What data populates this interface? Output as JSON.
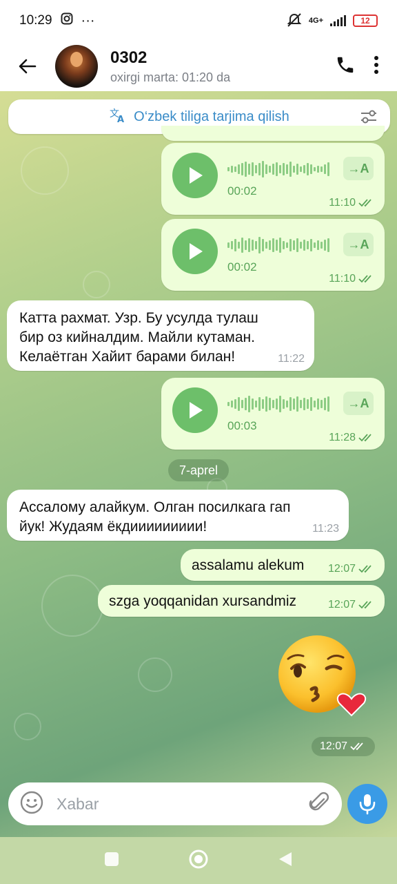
{
  "status_bar": {
    "time": "10:29",
    "network": "4G+",
    "battery": "12"
  },
  "header": {
    "name": "0302",
    "status": "oxirgi marta: 01:20 da"
  },
  "translate_bar": {
    "label": "O‘zbek tiliga tarjima qilish"
  },
  "messages": [
    {
      "type": "voice",
      "direction": "out",
      "duration": "00:02",
      "time": "11:10",
      "translate": "→A"
    },
    {
      "type": "voice",
      "direction": "out",
      "duration": "00:02",
      "time": "11:10",
      "translate": "→A"
    },
    {
      "type": "text",
      "direction": "in",
      "lines": [
        "Катта рахмат. Узр. Бу усулда тулаш",
        "бир оз кийналдим. Майли кутаман.",
        "Келаётган Хайит барами билан!"
      ],
      "time": "11:22"
    },
    {
      "type": "voice",
      "direction": "out",
      "duration": "00:03",
      "time": "11:28",
      "translate": "→A"
    },
    {
      "type": "date",
      "label": "7-aprel"
    },
    {
      "type": "text",
      "direction": "in",
      "lines": [
        "Ассалому алайкум.  Олган посилкага гап",
        "йук! Жудаям ёкдиииииииии!"
      ],
      "time": "11:23"
    },
    {
      "type": "text",
      "direction": "out",
      "lines": [
        "assalamu alekum"
      ],
      "time": "12:07"
    },
    {
      "type": "text",
      "direction": "out",
      "lines": [
        "szga yoqqanidan xursandmiz"
      ],
      "time": "12:07"
    },
    {
      "type": "emoji",
      "direction": "out",
      "emoji": "face-blowing-a-kiss",
      "time": "12:07"
    }
  ],
  "input": {
    "placeholder": "Xabar"
  },
  "colors": {
    "out_bubble": "#eefed9",
    "accent_green": "#58a458",
    "mic_blue": "#3a9be6",
    "translate_blue": "#3a8cc8"
  }
}
